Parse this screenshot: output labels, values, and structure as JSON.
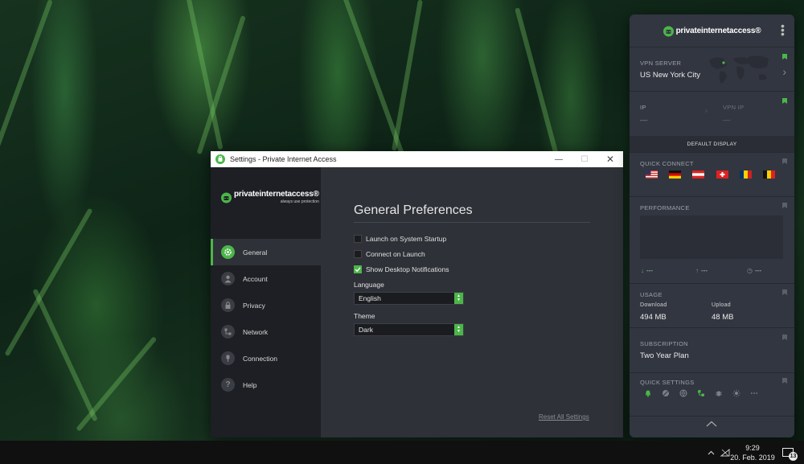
{
  "settings_window": {
    "title": "Settings - Private Internet Access",
    "controls": {
      "minimize": "—",
      "maximize": "☐",
      "close": "✕"
    },
    "logo_text": "privateinternetaccess®",
    "logo_tagline": "always use protection",
    "nav": [
      {
        "label": "General",
        "icon": "gear-icon",
        "active": true
      },
      {
        "label": "Account",
        "icon": "user-icon",
        "active": false
      },
      {
        "label": "Privacy",
        "icon": "lock-icon",
        "active": false
      },
      {
        "label": "Network",
        "icon": "network-icon",
        "active": false
      },
      {
        "label": "Connection",
        "icon": "connection-icon",
        "active": false
      },
      {
        "label": "Help",
        "icon": "help-icon",
        "active": false
      }
    ],
    "general": {
      "heading": "General Preferences",
      "options": [
        {
          "label": "Launch on System Startup",
          "checked": false
        },
        {
          "label": "Connect on Launch",
          "checked": false
        },
        {
          "label": "Show Desktop Notifications",
          "checked": true
        }
      ],
      "language_label": "Language",
      "language_value": "English",
      "theme_label": "Theme",
      "theme_value": "Dark",
      "reset_link": "Reset All Settings"
    }
  },
  "dashboard": {
    "logo_text": "privateinternetaccess®",
    "vpn_server_label": "VPN SERVER",
    "vpn_server_value": "US New York City",
    "ip_label": "IP",
    "ip_value": "—",
    "vpn_ip_label": "VPN IP",
    "vpn_ip_value": "—",
    "default_display": "DEFAULT DISPLAY",
    "quick_connect_label": "QUICK CONNECT",
    "quick_connect_flags": [
      "us-flag",
      "de-flag",
      "at-flag",
      "ch-flag",
      "ro-flag",
      "be-flag"
    ],
    "performance_label": "PERFORMANCE",
    "perf_download": "---",
    "perf_upload": "---",
    "perf_time": "---",
    "usage_label": "USAGE",
    "download_label": "Download",
    "download_value": "494 MB",
    "upload_label": "Upload",
    "upload_value": "48 MB",
    "subscription_label": "SUBSCRIPTION",
    "subscription_value": "Two Year Plan",
    "quick_settings_label": "QUICK SETTINGS",
    "quick_settings_icons": [
      "bell-icon",
      "block-icon",
      "globe-icon",
      "network-icon",
      "bug-icon",
      "brightness-icon",
      "more-icon"
    ]
  },
  "taskbar": {
    "time": "9:29",
    "date": "20. Feb. 2019",
    "notification_count": "13"
  },
  "colors": {
    "accent_green": "#4cb649",
    "sidebar_bg": "#1d1f24",
    "content_bg": "#2e3138",
    "dashboard_bg": "#323640"
  }
}
